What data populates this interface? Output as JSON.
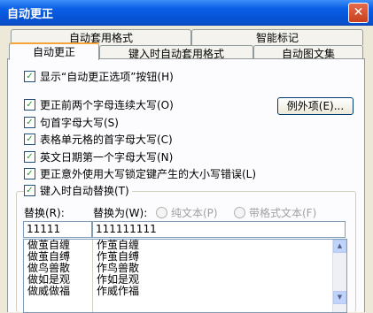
{
  "window": {
    "title": "自动更正",
    "close_glyph": "✕"
  },
  "tabs_row1": [
    "自动套用格式",
    "智能标记"
  ],
  "tabs_row2": [
    "自动更正",
    "键入时自动套用格式",
    "自动图文集"
  ],
  "options": {
    "show_button": "显示“自动更正选项”按钮(H)",
    "two_initial_caps": "更正前两个字母连续大写(O)",
    "capitalize_sentence": "句首字母大写(S)",
    "capitalize_table_cells": "表格单元格的首字母大写(C)",
    "capitalize_days": "英文日期第一个字母大写(N)",
    "caps_lock": "更正意外使用大写锁定键产生的大小写错误(L)",
    "replace_as_type": "键入时自动替换(T)"
  },
  "exceptions_button": "例外项(E)...",
  "replace": {
    "replace_label": "替换(R):",
    "with_label": "替换为(W):",
    "plain_text": "纯文本(P)",
    "formatted_text": "带格式文本(F)",
    "replace_value": "11111",
    "with_value": "111111111"
  },
  "entries": [
    {
      "from": "做茧自缠",
      "to": "作茧自缠"
    },
    {
      "from": "做茧自缚",
      "to": "作茧自缚"
    },
    {
      "from": "做鸟兽散",
      "to": "作鸟兽散"
    },
    {
      "from": "做如是观",
      "to": "作如是观"
    },
    {
      "from": "做威做福",
      "to": "作威作福"
    }
  ],
  "check_mark": "✓",
  "scroll": {
    "up": "▲",
    "down": "▼"
  }
}
